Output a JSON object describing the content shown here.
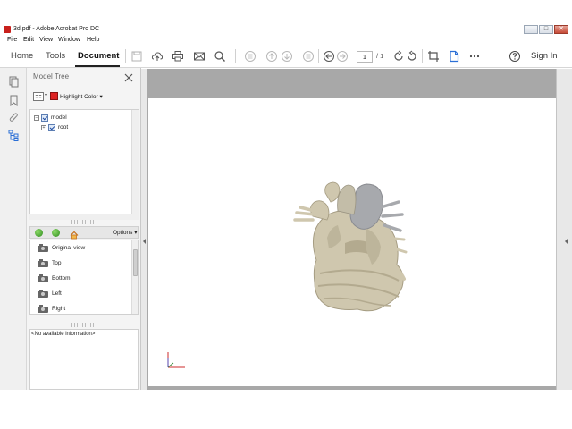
{
  "window": {
    "title": "3d.pdf - Adobe Acrobat Pro DC",
    "controls": [
      "–",
      "□",
      "✕"
    ]
  },
  "menu": [
    "File",
    "Edit",
    "View",
    "Window",
    "Help"
  ],
  "toolbar": {
    "tabs": [
      "Home",
      "Tools",
      "Document"
    ],
    "active_tab": "Document",
    "page_current": "1",
    "page_total": "/ 1",
    "sign_in": "Sign In",
    "icons": [
      "save-icon",
      "upload-icon",
      "print-icon",
      "email-icon",
      "search-icon",
      "scroll-up-icon",
      "page-up-icon",
      "page-down-icon",
      "scroll-down-icon",
      "prev-view-icon",
      "next-view-icon",
      "rotate-ccw-icon",
      "rotate-cw-icon",
      "trim-icon",
      "document-icon",
      "more-icon",
      "help-icon"
    ]
  },
  "rail": {
    "icons": [
      "pages-icon",
      "bookmark-icon",
      "attachment-icon",
      "model-tree-icon"
    ]
  },
  "panel": {
    "title": "Model Tree",
    "highlight_label": "Highlight Color",
    "highlight_color": "#d22222",
    "tree": [
      {
        "label": "model",
        "expander": "−"
      },
      {
        "label": "root",
        "expander": "+"
      }
    ],
    "views_options": "Options",
    "views": [
      "Original view",
      "Top",
      "Bottom",
      "Left",
      "Right"
    ],
    "info": "<No available information>"
  },
  "colors": {
    "accent": "#2b6fd6",
    "doc_background": "#a8a8a8",
    "model_bone": "#cfc7ae",
    "model_vessel": "#a7a9ad"
  }
}
